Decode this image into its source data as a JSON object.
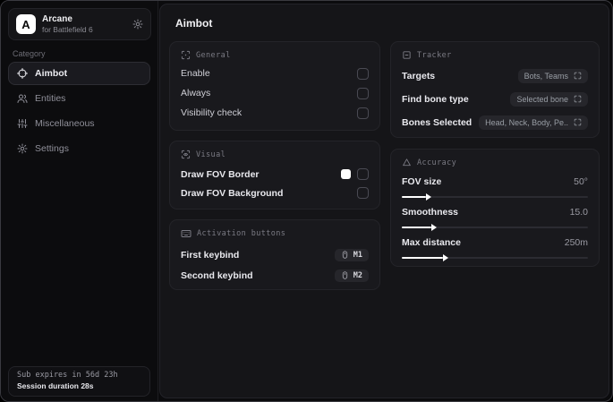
{
  "app": {
    "name": "Arcane",
    "subtitle": "for Battlefield 6",
    "logo_letter": "A"
  },
  "sidebar": {
    "category_label": "Category",
    "items": [
      {
        "label": "Aimbot",
        "icon": "crosshair-icon",
        "active": true
      },
      {
        "label": "Entities",
        "icon": "users-icon",
        "active": false
      },
      {
        "label": "Miscellaneous",
        "icon": "sliders-icon",
        "active": false
      },
      {
        "label": "Settings",
        "icon": "gear-icon",
        "active": false
      }
    ],
    "subscription": {
      "expires_text": "Sub expires in 56d 23h",
      "session_text": "Session duration 28s"
    }
  },
  "main": {
    "title": "Aimbot",
    "panels": {
      "general": {
        "title": "General",
        "rows": [
          {
            "label": "Enable",
            "checked": false
          },
          {
            "label": "Always",
            "checked": false
          },
          {
            "label": "Visibility check",
            "checked": false
          }
        ]
      },
      "visual": {
        "title": "Visual",
        "rows": [
          {
            "label": "Draw FOV Border",
            "swatch_color": "#ffffff",
            "checked": false
          },
          {
            "label": "Draw FOV Background",
            "checked": false
          }
        ]
      },
      "activation": {
        "title": "Activation buttons",
        "rows": [
          {
            "label": "First keybind",
            "key": "M1"
          },
          {
            "label": "Second keybind",
            "key": "M2"
          }
        ]
      },
      "tracker": {
        "title": "Tracker",
        "rows": [
          {
            "label": "Targets",
            "value": "Bots, Teams"
          },
          {
            "label": "Find bone type",
            "value": "Selected bone"
          },
          {
            "label": "Bones Selected",
            "value": "Head, Neck, Body, Pe.."
          }
        ]
      },
      "accuracy": {
        "title": "Accuracy",
        "sliders": [
          {
            "label": "FOV size",
            "value": "50°",
            "fill_pct": 13
          },
          {
            "label": "Smoothness",
            "value": "15.0",
            "fill_pct": 16
          },
          {
            "label": "Max distance",
            "value": "250m",
            "fill_pct": 22
          }
        ]
      }
    }
  },
  "colors": {
    "accent": "#ffffff",
    "fov_border_swatch": "#ffffff",
    "panel_bg": "#19191d"
  }
}
